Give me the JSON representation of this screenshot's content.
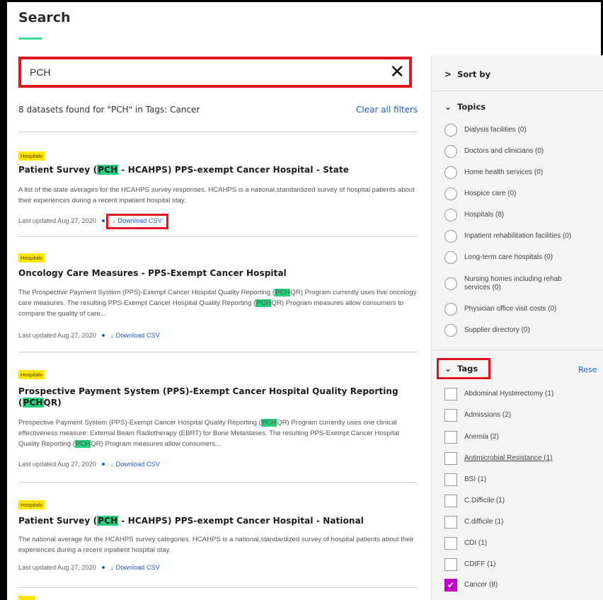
{
  "page": {
    "title": "Search"
  },
  "search": {
    "value": "PCH"
  },
  "results_summary": {
    "count_text": "8 datasets found for \"PCH\" in Tags: Cancer",
    "clear_label": "Clear all filters"
  },
  "results": [
    {
      "badge": "Hospitals",
      "title_pre": "Patient Survey (",
      "title_hl": "PCH",
      "title_post": " - HCAHPS) PPS-exempt Cancer Hospital - State",
      "desc": "A list of the state averages for the HCAHPS survey responses. HCAHPS is a national,standardized survey of hospital patients about their experiences during a recent inpatient hospital stay.",
      "updated": "Last updated Aug 27, 2020",
      "download": "Download CSV"
    },
    {
      "badge": "Hospitals",
      "title": "Oncology Care Measures - PPS-Exempt Cancer Hospital",
      "desc_a": "The Prospective Payment System (PPS)-Exempt Cancer Hospital Quality Reporting (",
      "desc_hl1": "PCH",
      "desc_b": "QR) Program currently uses five oncology care measures. The resulting PPS-Exempt Cancer Hospital Quality Reporting (",
      "desc_hl2": "PCH",
      "desc_c": "QR) Program measures allow consumers to compare the quality of care...",
      "updated": "Last updated Aug 27, 2020",
      "download": "Download CSV"
    },
    {
      "badge": "Hospitals",
      "title_pre": "Prospective Payment System (PPS)-Exempt Cancer Hospital Quality Reporting (",
      "title_hl": "PCH",
      "title_post": "QR)",
      "desc_a": "Prospective Payment System (PPS)-Exempt Cancer Hospital Quality Reporting (",
      "desc_hl1": "PCH",
      "desc_b": "QR) Program currently uses one clinical effectiveness measure: External Beam Radiotherapy (EBRT) for Bone Metastases. The resulting PPS-Exempt Cancer Hospital Quality Reporting (",
      "desc_hl2": "PCH",
      "desc_c": "QR) Program measures allow consumers...",
      "updated": "Last updated Aug 27, 2020",
      "download": "Download CSV"
    },
    {
      "badge": "Hospitals",
      "title_pre": "Patient Survey (",
      "title_hl": "PCH",
      "title_post": " - HCAHPS) PPS-exempt Cancer Hospital - National",
      "desc": "The national average for the HCAHPS survey categories. HCAHPS is a national,standardized survey of hospital patients about their experiences during a recent inpatient hospital stay.",
      "updated": "Last updated Aug 27, 2020",
      "download": "Download CSV"
    }
  ],
  "sidebar": {
    "sort_label": "Sort by",
    "topics_label": "Topics",
    "topics": [
      "Dialysis facilities (0)",
      "Doctors and clinicians (0)",
      "Home health services (0)",
      "Hospice care (0)",
      "Hospitals (8)",
      "Inpatient rehabilitation facilities (0)",
      "Long-term care hospitals (0)",
      "Nursing homes including rehab services (0)",
      "Physician office visit costs (0)",
      "Supplier directory (0)"
    ],
    "tags_label": "Tags",
    "reset_label": "Rese",
    "tags": [
      {
        "label": "Abdominal Hysterectomy (1)",
        "checked": false
      },
      {
        "label": "Admissions (2)",
        "checked": false
      },
      {
        "label": "Anemia (2)",
        "checked": false
      },
      {
        "label": "Antimicrobial Resistance (1)",
        "checked": false
      },
      {
        "label": "BSI (1)",
        "checked": false
      },
      {
        "label": "C.Difficile (1)",
        "checked": false
      },
      {
        "label": "C.difficile (1)",
        "checked": false
      },
      {
        "label": "CDI (1)",
        "checked": false
      },
      {
        "label": "CDIFF (1)",
        "checked": false
      },
      {
        "label": "Cancer (8)",
        "checked": true
      }
    ]
  },
  "colors": {
    "accent_green": "#26d07c",
    "badge_yellow": "#ffe600",
    "link_blue": "#1f5fbf",
    "highlight_red": "#e0131f",
    "check_magenta": "#c000c8"
  },
  "icons": {
    "clear": "close-icon",
    "chevron": "chevron-icon",
    "download": "download-icon",
    "check": "checkmark-icon"
  }
}
